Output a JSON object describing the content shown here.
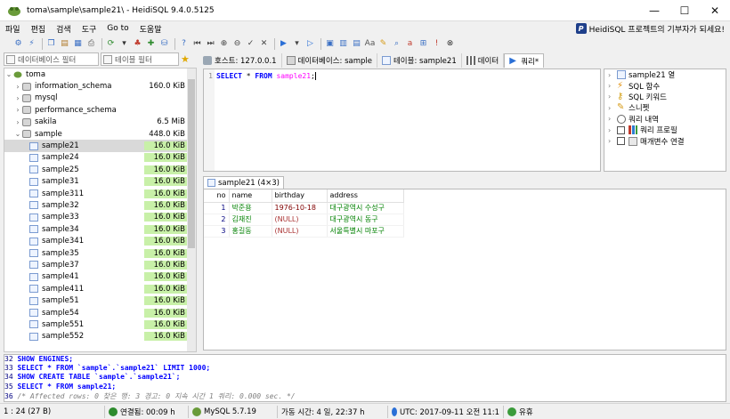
{
  "window": {
    "title": "toma\\sample\\sample21\\ - HeidiSQL 9.4.0.5125",
    "controls": {
      "minimize": "—",
      "maximize": "☐",
      "close": "✕"
    }
  },
  "menu": {
    "items": [
      "파일",
      "편집",
      "검색",
      "도구",
      "Go to",
      "도움말"
    ],
    "donate": "HeidiSQL 프로젝트의 기부자가 되세요!"
  },
  "filters": {
    "database": "데이터베이스 필터",
    "table": "테이블 필터"
  },
  "tree": {
    "root": "toma",
    "databases": [
      {
        "name": "information_schema",
        "size": "160.0 KiB"
      },
      {
        "name": "mysql",
        "size": ""
      },
      {
        "name": "performance_schema",
        "size": ""
      },
      {
        "name": "sakila",
        "size": "6.5 MiB"
      },
      {
        "name": "sample",
        "size": "448.0 KiB"
      }
    ],
    "tables": [
      {
        "name": "sample21",
        "size": "16.0 KiB"
      },
      {
        "name": "sample24",
        "size": "16.0 KiB"
      },
      {
        "name": "sample25",
        "size": "16.0 KiB"
      },
      {
        "name": "sample31",
        "size": "16.0 KiB"
      },
      {
        "name": "sample311",
        "size": "16.0 KiB"
      },
      {
        "name": "sample32",
        "size": "16.0 KiB"
      },
      {
        "name": "sample33",
        "size": "16.0 KiB"
      },
      {
        "name": "sample34",
        "size": "16.0 KiB"
      },
      {
        "name": "sample341",
        "size": "16.0 KiB"
      },
      {
        "name": "sample35",
        "size": "16.0 KiB"
      },
      {
        "name": "sample37",
        "size": "16.0 KiB"
      },
      {
        "name": "sample41",
        "size": "16.0 KiB"
      },
      {
        "name": "sample411",
        "size": "16.0 KiB"
      },
      {
        "name": "sample51",
        "size": "16.0 KiB"
      },
      {
        "name": "sample54",
        "size": "16.0 KiB"
      },
      {
        "name": "sample551",
        "size": "16.0 KiB"
      },
      {
        "name": "sample552",
        "size": "16.0 KiB"
      }
    ]
  },
  "tabs": [
    {
      "label": "호스트: 127.0.0.1"
    },
    {
      "label": "데이터베이스: sample"
    },
    {
      "label": "테이블: sample21"
    },
    {
      "label": "데이터"
    },
    {
      "label": "쿼리*"
    }
  ],
  "editor": {
    "line_number": "1",
    "kw1": "SELECT",
    "star": "*",
    "kw2": "FROM",
    "table": "sample21",
    "end": ";"
  },
  "helper": {
    "items": [
      {
        "label": "sample21 열",
        "checkbox": false
      },
      {
        "label": "SQL 함수",
        "checkbox": false
      },
      {
        "label": "SQL 키워드",
        "checkbox": false
      },
      {
        "label": "스니펫",
        "checkbox": false
      },
      {
        "label": "쿼리 내역",
        "checkbox": false
      },
      {
        "label": "쿼리 프로필",
        "checkbox": true
      },
      {
        "label": "매개변수 연결",
        "checkbox": true
      }
    ]
  },
  "results": {
    "tab_label": "sample21 (4×3)",
    "columns": [
      "no",
      "name",
      "birthday",
      "address"
    ],
    "rows": [
      [
        "1",
        "박준용",
        "1976-10-18",
        "대구광역시 수성구"
      ],
      [
        "2",
        "김재진",
        "(NULL)",
        "대구광역시 동구"
      ],
      [
        "3",
        "홍길동",
        "(NULL)",
        "서울특별시 마포구"
      ]
    ]
  },
  "log": {
    "lines": [
      {
        "n": "32",
        "text": "SHOW ENGINES;"
      },
      {
        "n": "33",
        "text": "SELECT * FROM `sample`.`sample21` LIMIT 1000;"
      },
      {
        "n": "34",
        "text": "SHOW CREATE TABLE `sample`.`sample21`;"
      },
      {
        "n": "35",
        "text": "SELECT * FROM sample21;"
      },
      {
        "n": "36",
        "text": "/* Affected rows: 0  찾은 행: 3  경고: 0  지속 시간 1 쿼리: 0.000 sec. */"
      }
    ]
  },
  "status": {
    "cursor": "1 : 24 (27 B)",
    "connected": "연결됨: 00:09 h",
    "server": "MySQL 5.7.19",
    "uptime": "가동 시간: 4 일, 22:37 h",
    "time": "UTC: 2017-09-11 오전 11:1",
    "state": "유휴"
  },
  "colors": {
    "size_bar": "#c8f0a8",
    "selected_row": "#d9d9d9",
    "keyword": "#0000ff",
    "table_name": "#ff00ff"
  }
}
